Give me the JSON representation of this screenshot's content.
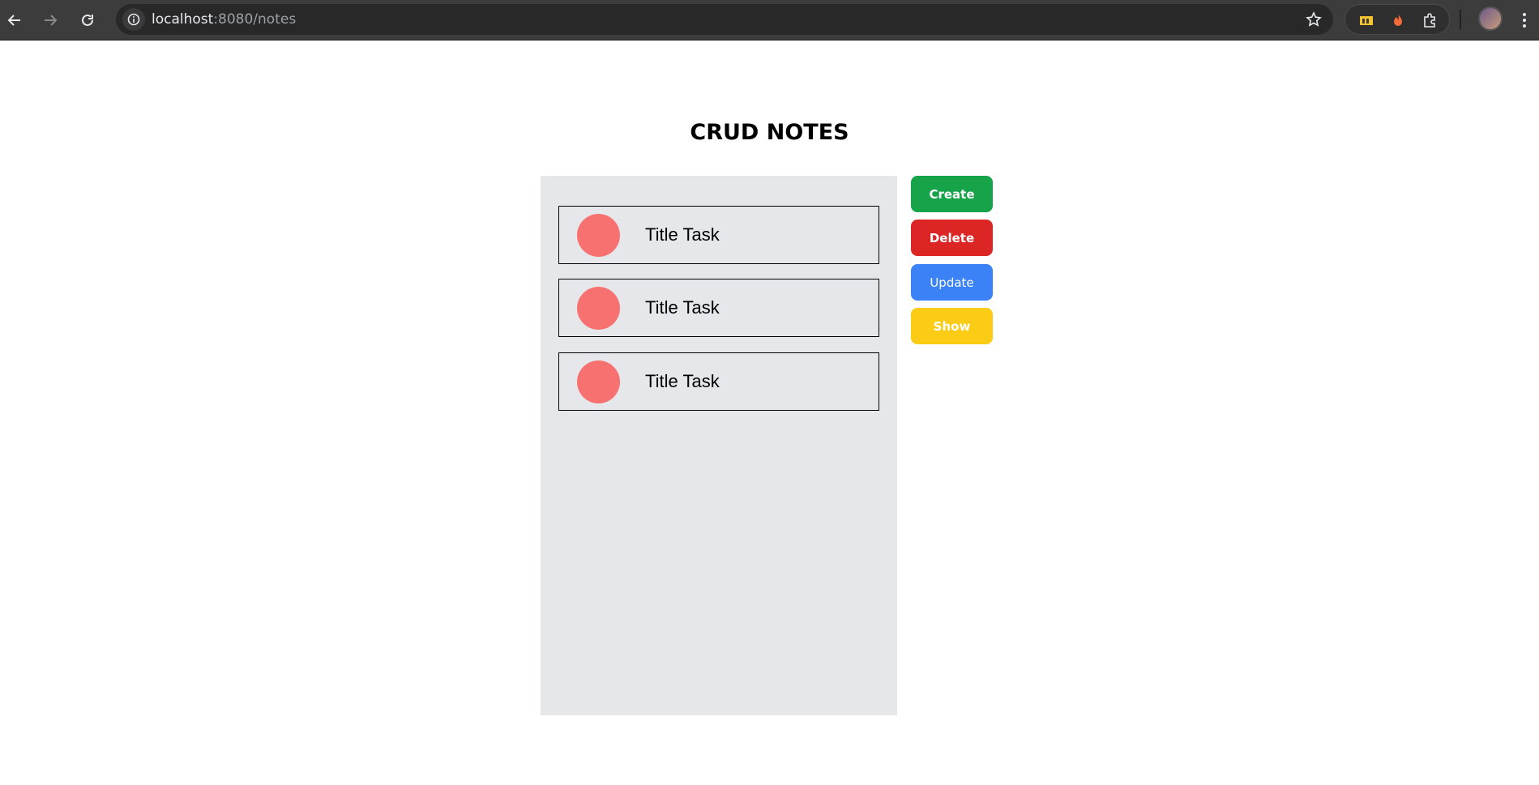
{
  "browser": {
    "url_host": "localhost",
    "url_path": ":8080/notes",
    "icons": [
      "back-arrow-icon",
      "forward-arrow-icon",
      "reload-icon",
      "site-info-icon",
      "star-icon",
      "extension-puzzle-icon",
      "fire-icon",
      "menu-icon"
    ]
  },
  "page": {
    "title": "CRUD NOTES"
  },
  "tasks": [
    {
      "title": "Title Task"
    },
    {
      "title": "Title Task"
    },
    {
      "title": "Title Task"
    }
  ],
  "actions": {
    "create": "Create",
    "delete": "Delete",
    "update": "Update",
    "show": "Show"
  },
  "colors": {
    "create": "#16a34a",
    "delete": "#dc2626",
    "update": "#3b82f6",
    "show": "#facc15",
    "task_dot": "#f87171",
    "panel": "#e5e7eb"
  }
}
